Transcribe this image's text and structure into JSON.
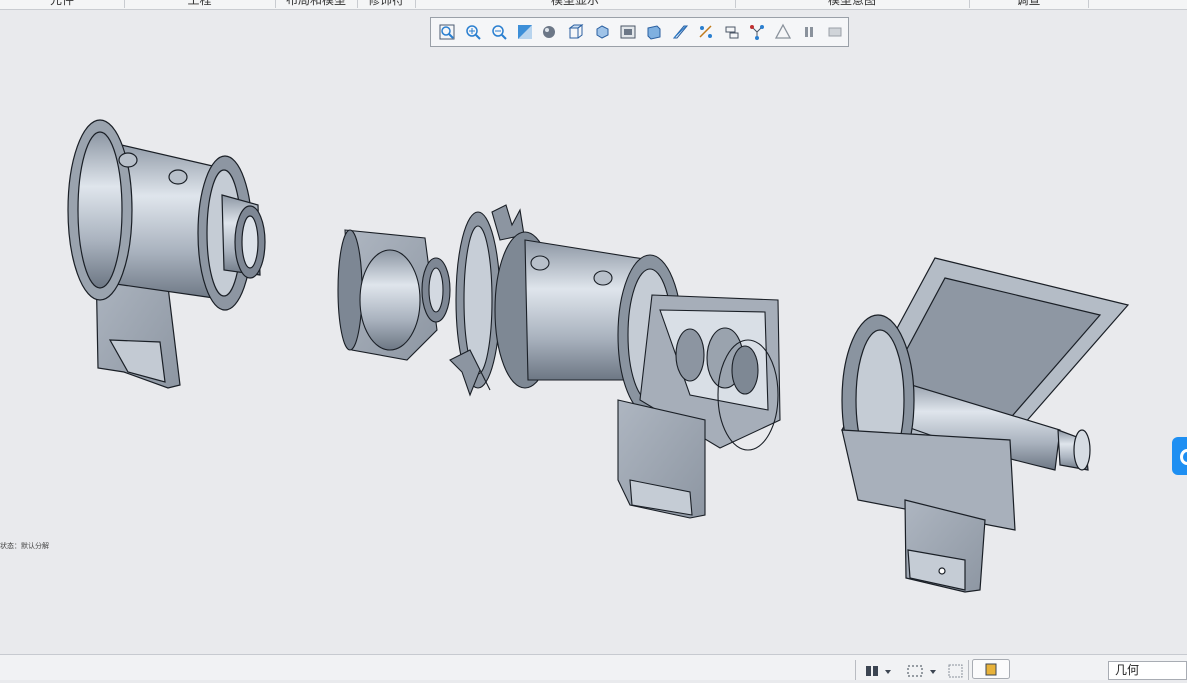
{
  "ribbon": {
    "groups": [
      "元件",
      "工程",
      "布局和模型",
      "修饰符",
      "模型显示",
      "模型意图",
      "调查"
    ]
  },
  "toolbar": {
    "buttons": [
      {
        "name": "refit-icon"
      },
      {
        "name": "zoom-in-icon"
      },
      {
        "name": "zoom-out-icon"
      },
      {
        "name": "repaint-icon"
      },
      {
        "name": "display-style-icon"
      },
      {
        "name": "saved-orientations-icon"
      },
      {
        "name": "view-manager-icon"
      },
      {
        "name": "perspective-view-icon"
      },
      {
        "name": "section-icon"
      },
      {
        "name": "datum-display-icon"
      },
      {
        "name": "annotation-display-icon"
      },
      {
        "name": "spin-center-icon"
      },
      {
        "name": "explode-icon"
      },
      {
        "name": "appearance-icon"
      },
      {
        "name": "pause-icon"
      },
      {
        "name": "next-icon"
      }
    ]
  },
  "viewport": {
    "state_label": "状态：默认分解"
  },
  "statusbar": {
    "filter_value": "几何"
  },
  "colors": {
    "background": "#e9eaed",
    "part_light": "#c9d0da",
    "part_dark": "#7b8592",
    "edge": "#1a1f26",
    "accent": "#1e8ff2"
  }
}
